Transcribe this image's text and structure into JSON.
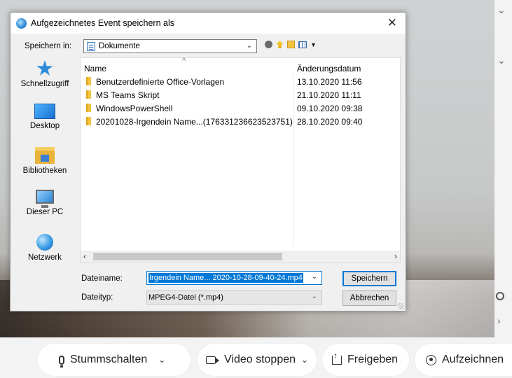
{
  "dialog": {
    "title": "Aufgezeichnetes Event speichern als",
    "save_in_label": "Speichern in:",
    "location": "Dokumente",
    "places": [
      {
        "label": "Schnellzugriff"
      },
      {
        "label": "Desktop"
      },
      {
        "label": "Bibliotheken"
      },
      {
        "label": "Dieser PC"
      },
      {
        "label": "Netzwerk"
      }
    ],
    "columns": {
      "name": "Name",
      "date": "Änderungsdatum"
    },
    "files": [
      {
        "name": "Benutzerdefinierte Office-Vorlagen",
        "date": "13.10.2020 11:56"
      },
      {
        "name": "MS Teams Skript",
        "date": "21.10.2020 11:11"
      },
      {
        "name": "WindowsPowerShell",
        "date": "09.10.2020 09:38"
      },
      {
        "name": "20201028-Irgendein Name...(176331236623523751)",
        "date": "28.10.2020 09:40"
      }
    ],
    "filename_label": "Dateiname:",
    "filename_value": "Irgendein Name... 2020-10-28-09-40-24.mp4",
    "filetype_label": "Dateityp:",
    "filetype_value": "MPEG4-Datei (*.mp4)",
    "save_button": "Speichern",
    "cancel_button": "Abbrechen"
  },
  "controls": {
    "mute": "Stummschalten",
    "video_stop": "Video stoppen",
    "share": "Freigeben",
    "record": "Aufzeichnen"
  },
  "colors": {
    "accent": "#0078d7"
  }
}
